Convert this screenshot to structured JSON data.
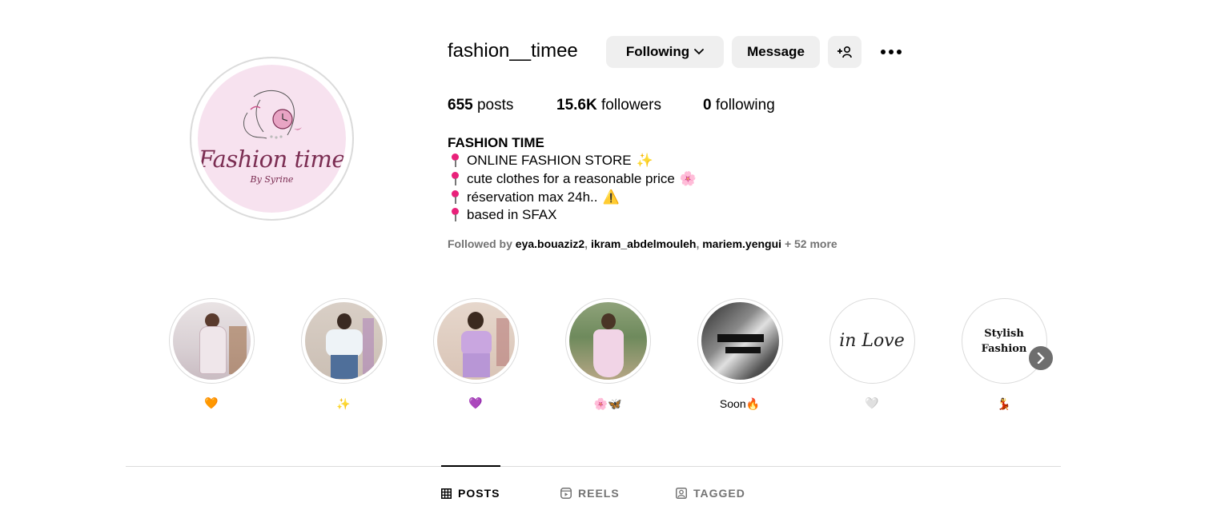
{
  "profile": {
    "username": "fashion__timee",
    "following_button": "Following",
    "message_button": "Message",
    "logo_title": "Fashion time",
    "logo_subtitle": "By Syrine"
  },
  "stats": {
    "posts_count": "655",
    "posts_label": "posts",
    "followers_count": "15.6K",
    "followers_label": "followers",
    "following_count": "0",
    "following_label": "following"
  },
  "bio": {
    "name": "FASHION TIME",
    "lines": [
      {
        "text": "ONLINE FASHION STORE",
        "emoji": "✨"
      },
      {
        "text": "cute clothes for a reasonable price",
        "emoji": "🌸"
      },
      {
        "text": "réservation max 24h..",
        "emoji": "⚠️"
      },
      {
        "text": "based in SFAX",
        "emoji": ""
      }
    ],
    "followed_by_prefix": "Followed by",
    "followed_by_names": [
      "eya.bouaziz2",
      "ikram_abdelmouleh",
      "mariem.yengui"
    ],
    "followed_by_more": "+ 52 more"
  },
  "highlights": [
    {
      "label": "🧡",
      "image": "girl-floral-dress"
    },
    {
      "label": "✨",
      "image": "girl-white-sweater"
    },
    {
      "label": "💜",
      "image": "girl-purple-top"
    },
    {
      "label": "🌸🦋",
      "image": "girl-pink-dress-outdoor"
    },
    {
      "label": "Soon🔥",
      "image": "black-white-collage"
    },
    {
      "label": "🤍",
      "image": "in-love-text"
    },
    {
      "label": "💃",
      "image": "stylish-fashion-text"
    }
  ],
  "highlight_texts": {
    "in_love": "in Love",
    "stylish": "Stylish",
    "fashion": "Fashion"
  },
  "tabs": {
    "posts": "POSTS",
    "reels": "REELS",
    "tagged": "TAGGED"
  },
  "colors": {
    "button_bg": "#efefef",
    "logo_pink": "#f7e2ef",
    "logo_text": "#7b2d52",
    "secondary_text": "#737373",
    "divider": "#dbdbdb"
  }
}
